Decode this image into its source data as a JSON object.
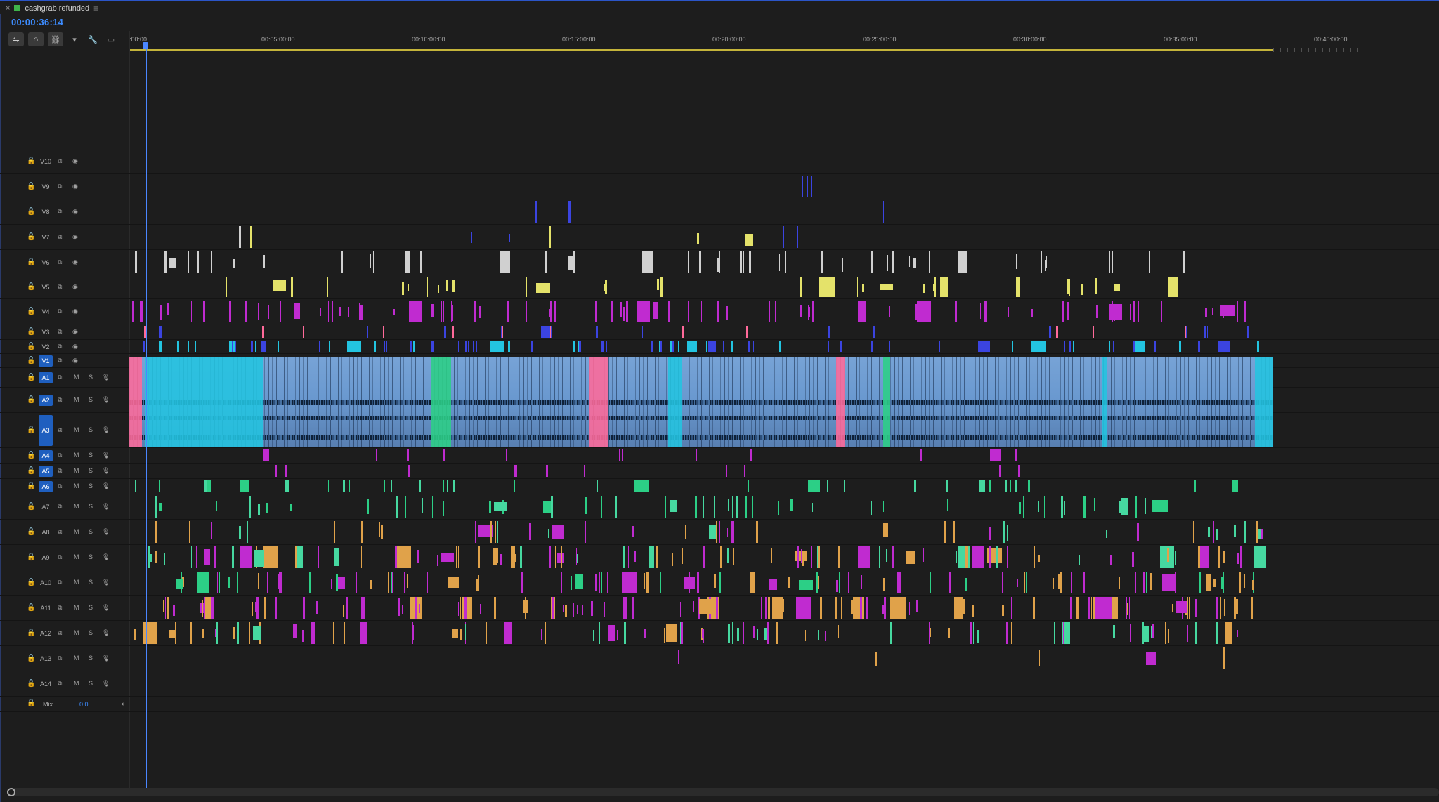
{
  "sequence": {
    "name": "cashgrab refunded",
    "timecode": "00:00:36:14"
  },
  "toolbar": {
    "icons": [
      "nest-sequence-icon",
      "snap-magnet-icon",
      "linked-selection-icon",
      "add-marker-icon",
      "wrench-settings-icon",
      "captions-icon"
    ]
  },
  "ruler": {
    "labels": [
      ":00:00",
      "00:05:00:00",
      "00:10:00:00",
      "00:15:00:00",
      "00:20:00:00",
      "00:25:00:00",
      "00:30:00:00",
      "00:35:00:00",
      "00:40:00:00"
    ],
    "work_area_end_fraction": 0.887
  },
  "playhead": {
    "timecode": "00:00:36:14"
  },
  "tracks": {
    "video": [
      "V10",
      "V9",
      "V8",
      "V7",
      "V6",
      "V5",
      "V4",
      "V3",
      "V2",
      "V1"
    ],
    "audio": [
      "A1",
      "A2",
      "A3",
      "A4",
      "A5",
      "A6",
      "A7",
      "A8",
      "A9",
      "A10",
      "A11",
      "A12",
      "A13",
      "A14"
    ],
    "active": [
      "V1",
      "A1",
      "A2",
      "A3",
      "A4",
      "A5",
      "A6"
    ],
    "mute_label": "M",
    "solo_label": "S"
  },
  "mix": {
    "label": "Mix",
    "value": "0.0"
  },
  "colors": {
    "accent": "#2b55c8",
    "timecode": "#3d8cff",
    "clip_blue": "#6a99d0",
    "clip_cyan": "#23c4e0",
    "clip_pink": "#ff6a9a",
    "clip_green": "#2ccf86",
    "clip_violet": "#c02bd0",
    "clip_white": "#d0d0d0",
    "clip_yellow": "#e4e26a",
    "clip_indigo": "#3b44e0",
    "clip_orange": "#e0a24a",
    "clip_mint": "#46d8a0"
  }
}
